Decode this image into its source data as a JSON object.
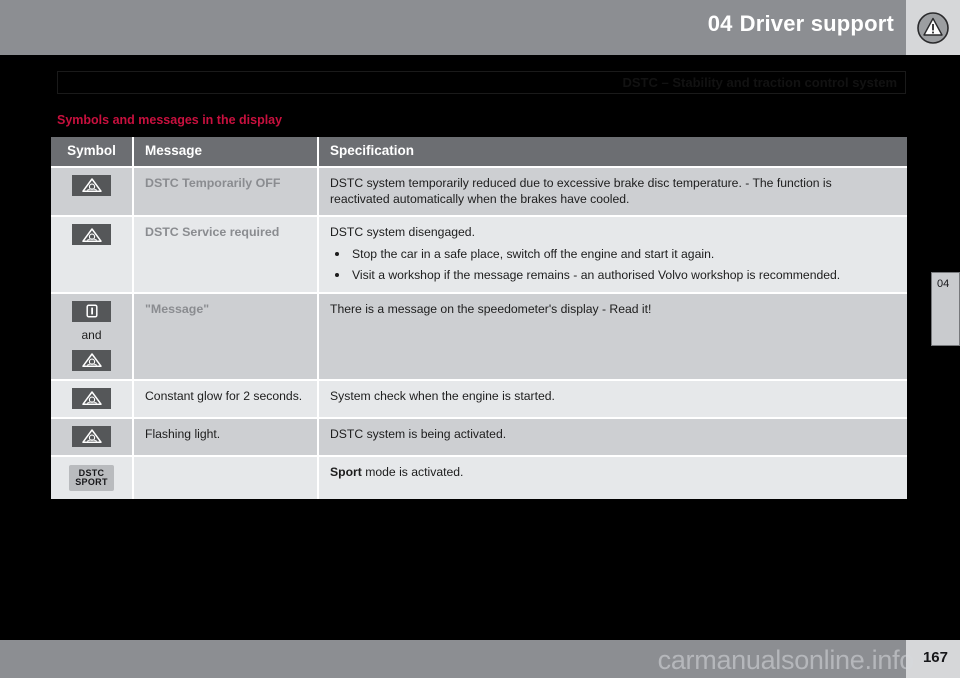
{
  "header": {
    "chapter_number": "04",
    "title": "Driver support",
    "icon": "warning-triangle-circle-icon"
  },
  "running_head": {
    "text": "DSTC – Stability and traction control system"
  },
  "section": {
    "heading": "Symbols and messages in the display",
    "heading_color": "#c8103e"
  },
  "table": {
    "columns": [
      "Symbol",
      "Message",
      "Specification"
    ],
    "rows": [
      {
        "symbols": [
          {
            "type": "dstc-warning-triangle-icon"
          }
        ],
        "message": "DSTC Temporarily OFF",
        "message_style": "grey-bold",
        "spec_text": "DSTC system temporarily reduced due to excessive brake disc temperature. - The function is reactivated automatically when the brakes have cooled.",
        "spec_bullets": []
      },
      {
        "symbols": [
          {
            "type": "dstc-warning-triangle-icon"
          }
        ],
        "message": "DSTC Service required",
        "message_style": "grey-bold",
        "spec_text": "DSTC system disengaged.",
        "spec_bullets": [
          "Stop the car in a safe place, switch off the engine and start it again.",
          "Visit a workshop if the message remains - an authorised Volvo workshop is recommended."
        ]
      },
      {
        "symbols": [
          {
            "type": "message-information-icon"
          },
          {
            "type": "and-separator",
            "label": "and"
          },
          {
            "type": "dstc-warning-triangle-icon"
          }
        ],
        "message": "\"Message\"",
        "message_style": "grey-bold",
        "spec_text": "There is a message on the speedometer's display - Read it!",
        "spec_bullets": []
      },
      {
        "symbols": [
          {
            "type": "dstc-warning-triangle-icon"
          }
        ],
        "message": "Constant glow for 2 seconds.",
        "message_style": "normal",
        "spec_text": "System check when the engine is started.",
        "spec_bullets": []
      },
      {
        "symbols": [
          {
            "type": "dstc-warning-triangle-icon"
          }
        ],
        "message": "Flashing light.",
        "message_style": "normal",
        "spec_text": "DSTC system is being activated.",
        "spec_bullets": []
      },
      {
        "symbols": [
          {
            "type": "dstc-sport-badge-icon",
            "line1": "DSTC",
            "line2": "SPORT"
          }
        ],
        "message": "",
        "message_style": "normal",
        "spec_text_bold": "Sport",
        "spec_text": " mode is activated.",
        "spec_bullets": []
      }
    ]
  },
  "chapter_tab": {
    "label": "04"
  },
  "footer": {
    "page_number": "167",
    "watermark": "carmanualsonline.info"
  }
}
